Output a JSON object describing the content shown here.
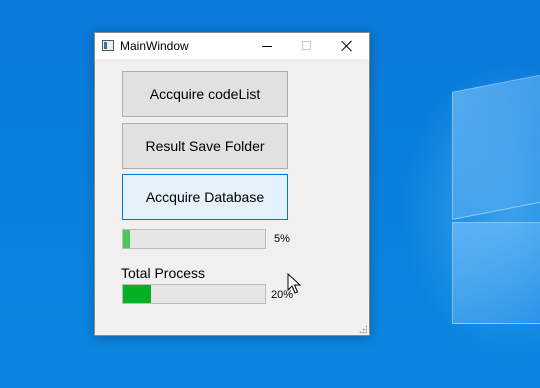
{
  "window": {
    "title": "MainWindow"
  },
  "buttons": {
    "acquire_codelist": "Accquire codeList",
    "result_save_folder": "Result Save Folder",
    "acquire_database": "Accquire Database"
  },
  "progress": {
    "current": {
      "value": 5,
      "label": "5%"
    },
    "total": {
      "caption": "Total Process",
      "value": 20,
      "label": "20%"
    }
  },
  "colors": {
    "desktop": "#0a79d8",
    "progress_fill": "#06b025",
    "focus_border": "#0078d7"
  },
  "icons": {
    "app": "window-app-icon",
    "minimize": "minimize-icon",
    "maximize": "maximize-icon",
    "close": "close-icon",
    "cursor": "mouse-pointer-icon"
  }
}
